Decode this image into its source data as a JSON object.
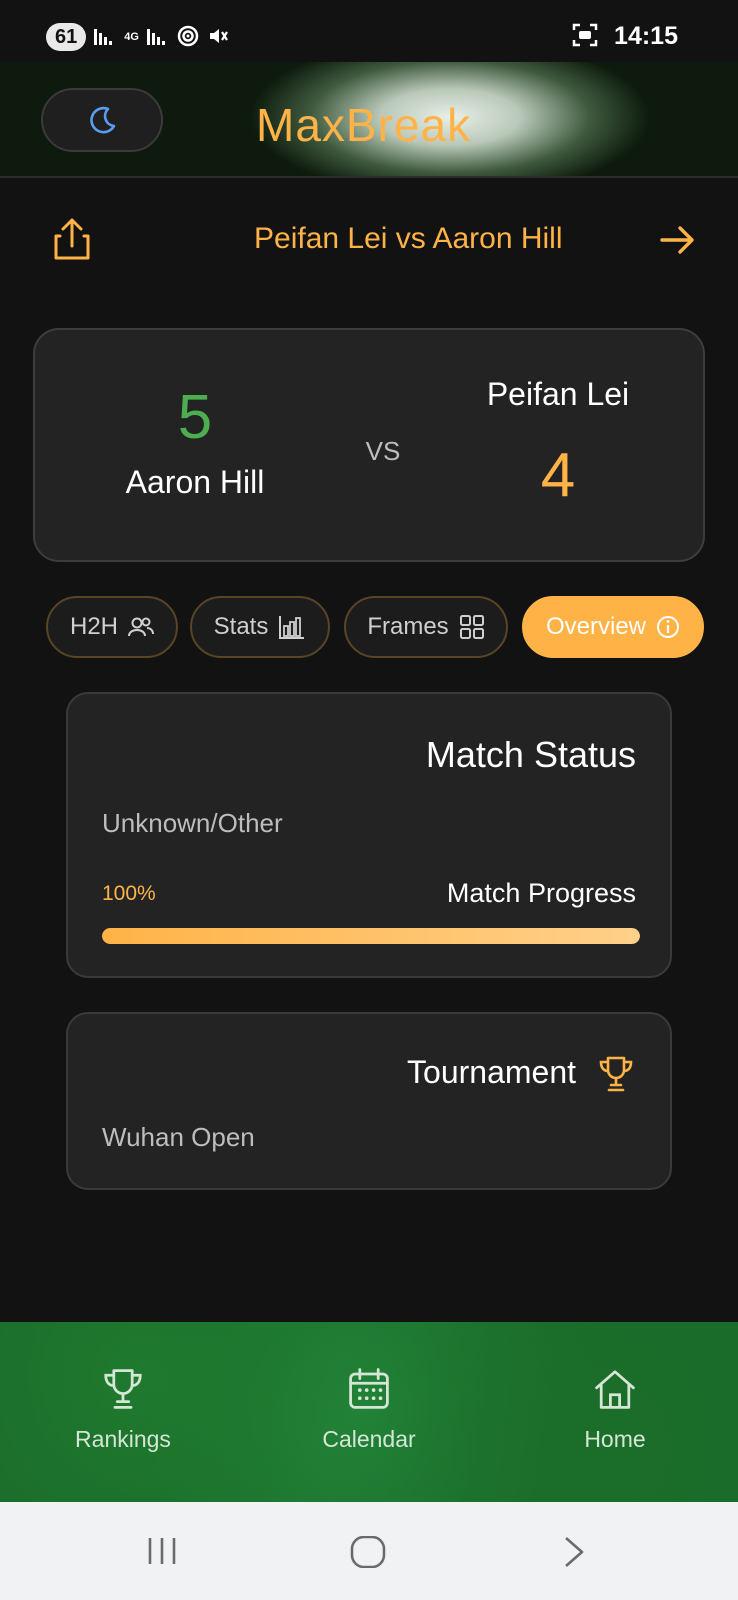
{
  "status_bar": {
    "battery": "61",
    "network": "4G",
    "time": "14:15"
  },
  "header": {
    "app_title": "MaxBreak",
    "theme_toggle_icon": "moon-icon"
  },
  "match": {
    "title": "Peifan Lei vs Aaron Hill",
    "share_icon": "share-icon",
    "next_icon": "arrow-right-icon"
  },
  "score": {
    "home_name": "Aaron Hill",
    "home_score": "5",
    "away_name": "Peifan Lei",
    "away_score": "4",
    "vs": "VS",
    "home_color": "#4cae4f",
    "away_color": "#ffb347"
  },
  "tabs": [
    {
      "label": "H2H",
      "icon": "users-icon",
      "active": false
    },
    {
      "label": "Stats",
      "icon": "bar-chart-icon",
      "active": false
    },
    {
      "label": "Frames",
      "icon": "grid-icon",
      "active": false
    },
    {
      "label": "Overview",
      "icon": "info-icon",
      "active": true
    }
  ],
  "status_card": {
    "heading": "Match Status",
    "value": "Unknown/Other",
    "progress_percent_label": "100%",
    "progress_label": "Match Progress",
    "progress_fraction": 1.0
  },
  "tournament_card": {
    "heading": "Tournament",
    "icon": "trophy-icon",
    "value": "Wuhan Open"
  },
  "bottom_nav": [
    {
      "label": "Rankings",
      "icon": "trophy-icon"
    },
    {
      "label": "Calendar",
      "icon": "calendar-icon"
    },
    {
      "label": "Home",
      "icon": "home-icon"
    }
  ],
  "colors": {
    "accent": "#ffb347",
    "background": "#121212",
    "card": "#232323",
    "nav_green": "#1a6b2a"
  }
}
